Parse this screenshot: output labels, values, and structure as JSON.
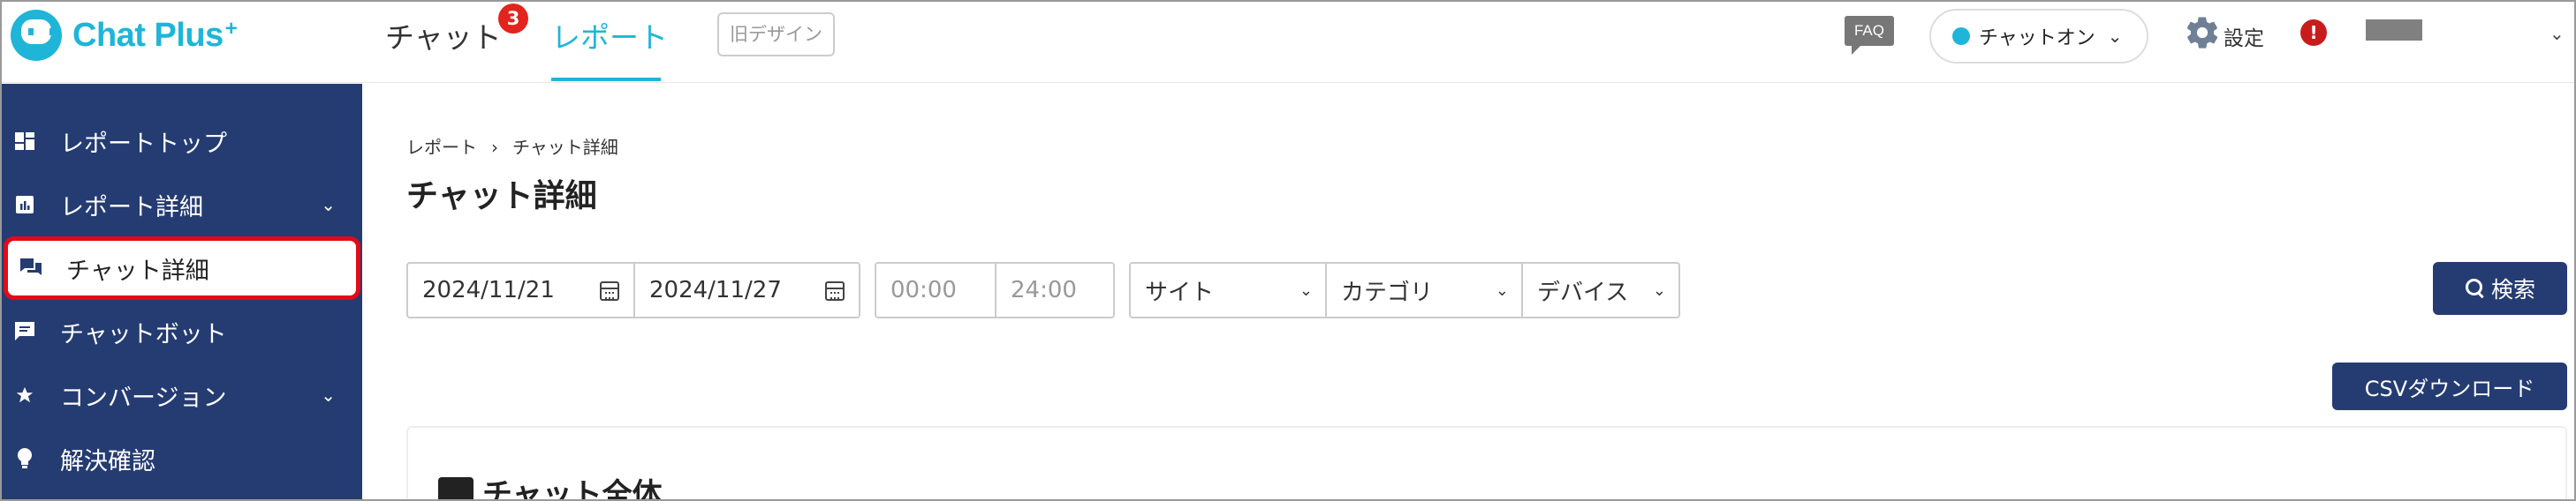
{
  "app": {
    "logo_text": "Chat Plus",
    "logo_sup": "+"
  },
  "header": {
    "nav": [
      {
        "label": "チャット",
        "badge": "3"
      },
      {
        "label": "レポート"
      }
    ],
    "old_design": "旧デザイン",
    "faq": "FAQ",
    "status": {
      "label": "チャットオン",
      "color": "#1fb5d8"
    },
    "settings": "設定",
    "alert": "!"
  },
  "sidebar": {
    "items": [
      {
        "label": "レポートトップ",
        "icon": "dashboard-icon"
      },
      {
        "label": "レポート詳細",
        "icon": "report-icon",
        "expandable": true
      },
      {
        "label": "チャット詳細",
        "icon": "chat-bubbles-icon",
        "active": true
      },
      {
        "label": "チャットボット",
        "icon": "chatbot-icon"
      },
      {
        "label": "コンバージョン",
        "icon": "star-icon",
        "expandable": true
      },
      {
        "label": "解決確認",
        "icon": "lightbulb-icon"
      }
    ]
  },
  "main": {
    "breadcrumb": [
      "レポート",
      "チャット詳細"
    ],
    "breadcrumb_sep": "›",
    "title": "チャット詳細",
    "date_from": "2024/11/21",
    "date_to": "2024/11/27",
    "time_from": "00:00",
    "time_to": "24:00",
    "filters": [
      "サイト",
      "カテゴリ",
      "デバイス"
    ],
    "search_label": "検索",
    "csv_label": "CSVダウンロード",
    "section_title": "チャット全体"
  },
  "colors": {
    "brand": "#1fb5d8",
    "navy": "#253c72",
    "highlight": "#e10b17",
    "badge": "#e2241d"
  }
}
